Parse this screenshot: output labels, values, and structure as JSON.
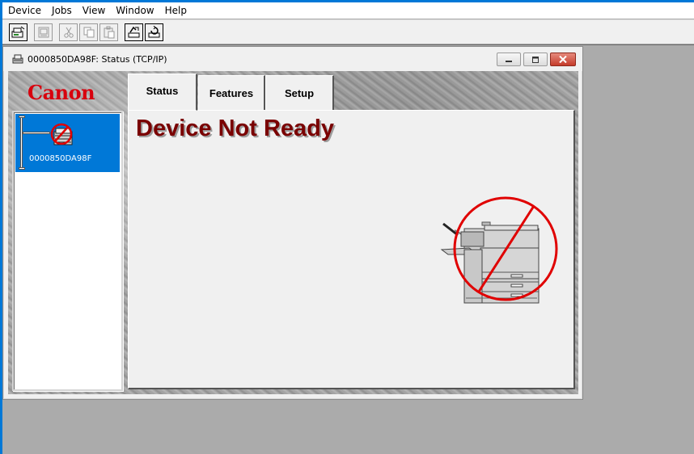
{
  "menubar": {
    "items": [
      {
        "label": "Device"
      },
      {
        "label": "Jobs"
      },
      {
        "label": "View"
      },
      {
        "label": "Window"
      },
      {
        "label": "Help"
      }
    ]
  },
  "toolbar": {
    "buttons": [
      {
        "icon": "print-icon",
        "enabled": true
      },
      {
        "icon": "properties-icon",
        "enabled": false
      },
      {
        "icon": "cut-icon",
        "enabled": false
      },
      {
        "icon": "copy-icon",
        "enabled": false
      },
      {
        "icon": "paste-icon",
        "enabled": false
      },
      {
        "icon": "pause-job-icon",
        "enabled": true
      },
      {
        "icon": "refresh-icon",
        "enabled": true
      }
    ]
  },
  "window": {
    "title": "0000850DA98F: Status  (TCP/IP)",
    "title_icon": "device-icon"
  },
  "brand": {
    "logo_text": "Canon",
    "color": "#d8000d"
  },
  "device_list": {
    "selected": {
      "label": "0000850DA98F",
      "icon": "device-error-icon"
    },
    "selection_color": "#0078d7"
  },
  "tabs": [
    {
      "label": "Status",
      "active": true
    },
    {
      "label": "Features",
      "active": false
    },
    {
      "label": "Setup",
      "active": false
    }
  ],
  "status": {
    "heading": "Device Not Ready",
    "heading_color": "#7a0000",
    "illustration": "printer-not-available-icon"
  }
}
